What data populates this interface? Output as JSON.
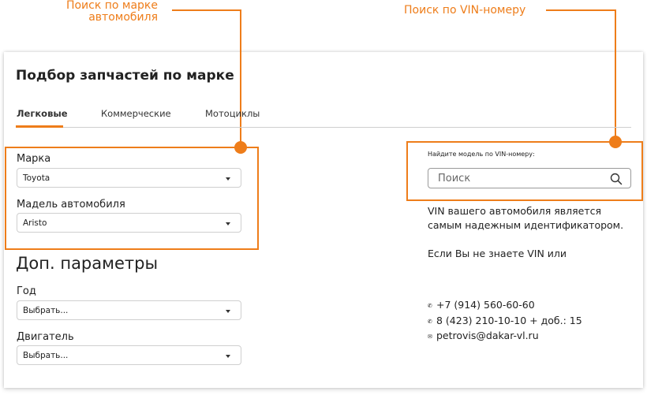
{
  "annotations": {
    "left": "Поиск по марке автомобиля",
    "right": "Поиск по VIN-номеру"
  },
  "colors": {
    "accent": "#ee7d1a",
    "border": "#cfcfcf"
  },
  "page_title": "Подбор запчастей по марке",
  "tabs": [
    {
      "label": "Легковые",
      "active": true
    },
    {
      "label": "Коммерческие",
      "active": false
    },
    {
      "label": "Мотоциклы",
      "active": false
    }
  ],
  "brand_search": {
    "make_label": "Марка",
    "make_value": "Toyota",
    "model_label": "Мадель автомобиля",
    "model_value": "Aristo"
  },
  "extra_params": {
    "title": "Доп. параметры",
    "year_label": "Год",
    "year_value": "Выбрать...",
    "engine_label": "Двигатель",
    "engine_value": "Выбрать..."
  },
  "vin": {
    "label": "Найдите модель по VIN-номеру:",
    "placeholder": "Поиск",
    "icon": "search-icon",
    "text_line1": "VIN вашего автомобиля является",
    "text_line2": "самым надежным идентификатором.",
    "text_line3": "Если Вы не знаете VIN или"
  },
  "contacts": {
    "phone1": "+7 (914) 560-60-60",
    "phone2": "8 (423) 210-10-10 + доб.: 15",
    "email": "petrovis@dakar-vl.ru",
    "phone_icon": "phone-icon",
    "email_icon": "mail-icon"
  }
}
